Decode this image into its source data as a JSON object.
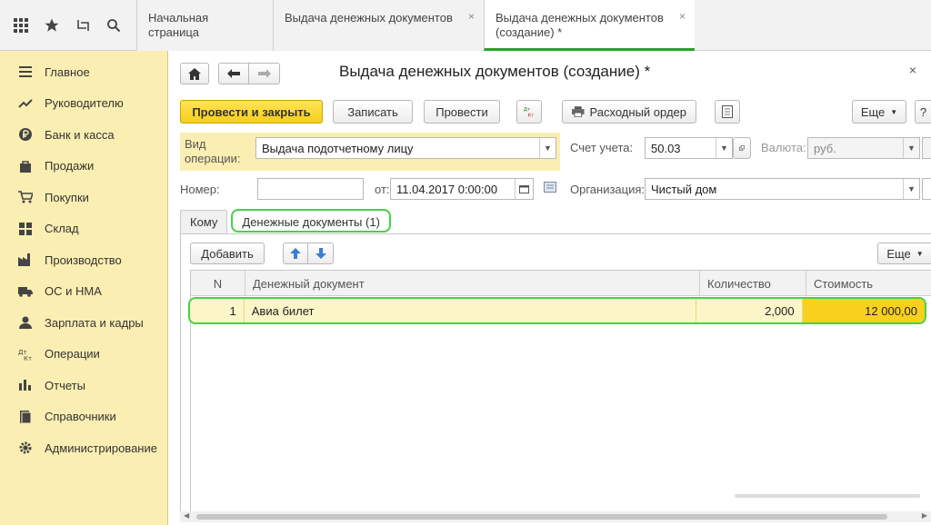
{
  "topbar": {
    "tabs": [
      {
        "label": "Начальная страница",
        "closable": false,
        "active": false
      },
      {
        "label": "Выдача денежных документов",
        "closable": true,
        "active": false
      },
      {
        "label": "Выдача денежных документов (создание) *",
        "closable": true,
        "active": true
      }
    ],
    "close_glyph": "×"
  },
  "sidebar": {
    "items": [
      {
        "label": "Главное",
        "icon": "menu-icon"
      },
      {
        "label": "Руководителю",
        "icon": "trend-icon"
      },
      {
        "label": "Банк и касса",
        "icon": "ruble-icon"
      },
      {
        "label": "Продажи",
        "icon": "bag-icon"
      },
      {
        "label": "Покупки",
        "icon": "cart-icon"
      },
      {
        "label": "Склад",
        "icon": "warehouse-icon"
      },
      {
        "label": "Производство",
        "icon": "factory-icon"
      },
      {
        "label": "ОС и НМА",
        "icon": "truck-icon"
      },
      {
        "label": "Зарплата и кадры",
        "icon": "person-icon"
      },
      {
        "label": "Операции",
        "icon": "dtkt-icon"
      },
      {
        "label": "Отчеты",
        "icon": "bar-chart-icon"
      },
      {
        "label": "Справочники",
        "icon": "book-icon"
      },
      {
        "label": "Администрирование",
        "icon": "gear-icon"
      }
    ]
  },
  "form": {
    "title": "Выдача денежных документов (создание) *",
    "buttons": {
      "post_close": "Провести и закрыть",
      "save": "Записать",
      "post": "Провести",
      "print_order": "Расходный ордер",
      "more": "Еще",
      "dtkt_top": "Дт",
      "dtkt_bottom": "Кт"
    },
    "fields": {
      "operation_label": "Вид операции:",
      "operation_value": "Выдача подотчетному лицу",
      "account_label": "Счет учета:",
      "account_value": "50.03",
      "currency_label": "Валюта:",
      "currency_value": "руб.",
      "number_label": "Номер:",
      "number_value": "",
      "date_label": "от:",
      "date_value": "11.04.2017  0:00:00",
      "org_label": "Организация:",
      "org_value": "Чистый дом"
    },
    "tabs": [
      {
        "label": "Кому",
        "active": false
      },
      {
        "label": "Денежные документы (1)",
        "active": true
      }
    ],
    "table": {
      "add_button": "Добавить",
      "more_button": "Еще",
      "columns": [
        "N",
        "Денежный документ",
        "Количество",
        "Стоимость"
      ],
      "rows": [
        {
          "n": "1",
          "doc": "Авиа билет",
          "qty": "2,000",
          "cost": "12 000,00"
        }
      ]
    }
  },
  "colors": {
    "accent_green": "#46d246",
    "primary_yellow": "#f6cf16",
    "sidebar_bg": "#fbeeb2"
  }
}
